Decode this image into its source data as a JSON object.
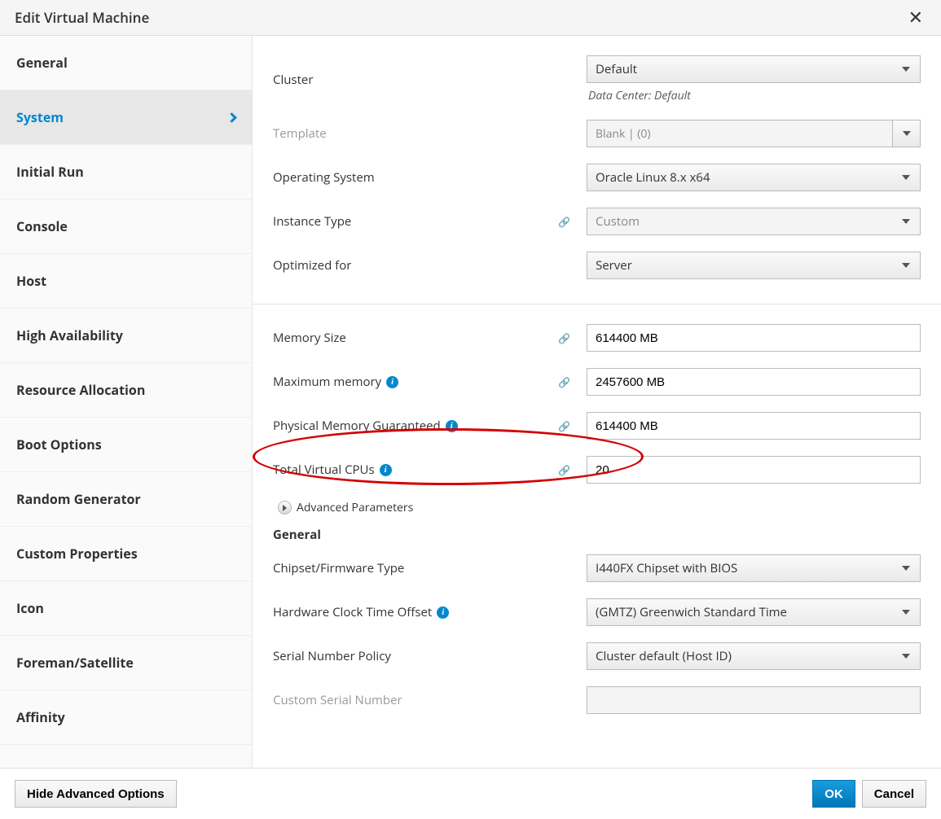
{
  "dialog": {
    "title": "Edit Virtual Machine"
  },
  "sidebar": {
    "items": [
      {
        "id": "general",
        "label": "General"
      },
      {
        "id": "system",
        "label": "System",
        "active": true
      },
      {
        "id": "initial-run",
        "label": "Initial Run"
      },
      {
        "id": "console",
        "label": "Console"
      },
      {
        "id": "host",
        "label": "Host"
      },
      {
        "id": "high-availability",
        "label": "High Availability"
      },
      {
        "id": "resource-allocation",
        "label": "Resource Allocation"
      },
      {
        "id": "boot-options",
        "label": "Boot Options"
      },
      {
        "id": "random-generator",
        "label": "Random Generator"
      },
      {
        "id": "custom-properties",
        "label": "Custom Properties"
      },
      {
        "id": "icon",
        "label": "Icon"
      },
      {
        "id": "foreman-satellite",
        "label": "Foreman/Satellite"
      },
      {
        "id": "affinity",
        "label": "Affinity"
      }
    ]
  },
  "labels": {
    "cluster": "Cluster",
    "datacenter_hint": "Data Center: Default",
    "template": "Template",
    "operating_system": "Operating System",
    "instance_type": "Instance Type",
    "optimized_for": "Optimized for",
    "memory_size": "Memory Size",
    "maximum_memory": "Maximum memory",
    "physical_memory_guaranteed": "Physical Memory Guaranteed",
    "total_virtual_cpus": "Total Virtual CPUs",
    "advanced_parameters": "Advanced Parameters",
    "general_sub": "General",
    "chipset_firmware_type": "Chipset/Firmware Type",
    "hardware_clock_time_offset": "Hardware Clock Time Offset",
    "serial_number_policy": "Serial Number Policy",
    "custom_serial_number": "Custom Serial Number"
  },
  "values": {
    "cluster": "Default",
    "template": "Blank |  (0)",
    "operating_system": "Oracle Linux 8.x x64",
    "instance_type": "Custom",
    "optimized_for": "Server",
    "memory_size": "614400 MB",
    "maximum_memory": "2457600 MB",
    "physical_memory_guaranteed": "614400 MB",
    "total_virtual_cpus": "20",
    "chipset_firmware_type": "I440FX Chipset with BIOS",
    "hardware_clock_time_offset": "(GMTZ) Greenwich Standard Time",
    "serial_number_policy": "Cluster default (Host ID)",
    "custom_serial_number": ""
  },
  "footer": {
    "hide_advanced": "Hide Advanced Options",
    "ok": "OK",
    "cancel": "Cancel"
  }
}
